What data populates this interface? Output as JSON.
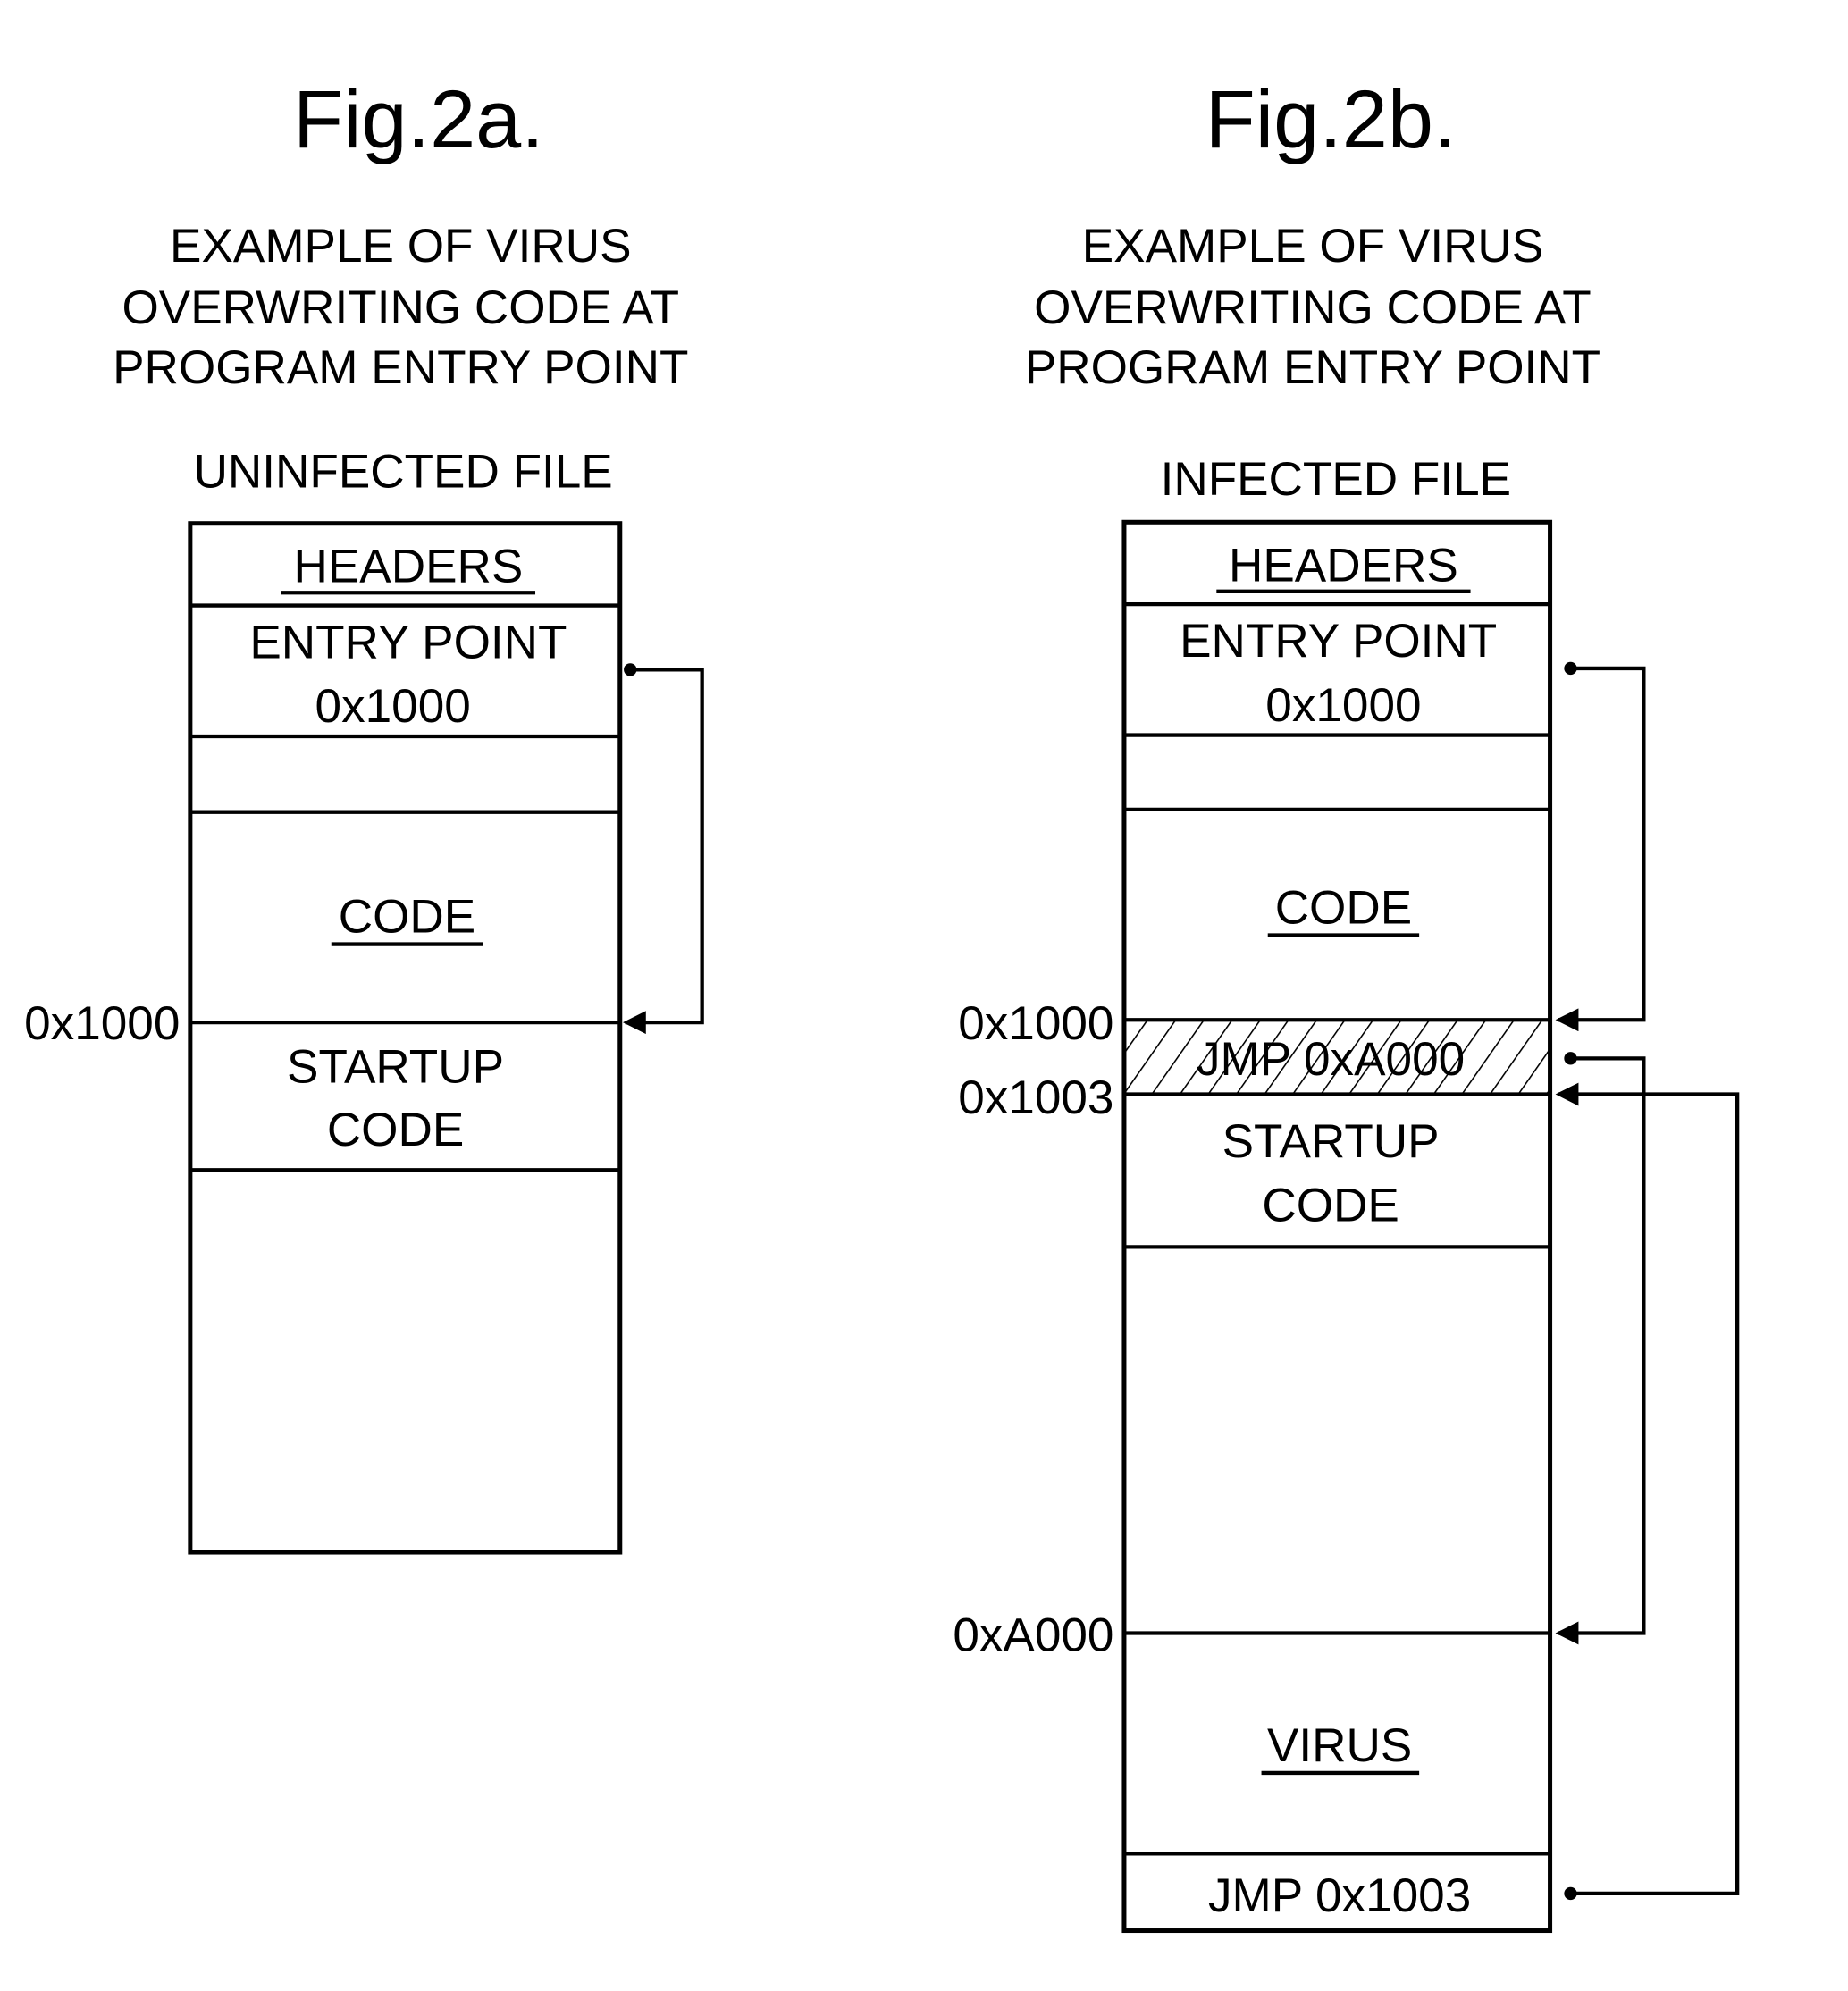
{
  "figures": [
    {
      "id": "fig2a",
      "title": "Fig.2a.",
      "caption": [
        "EXAMPLE OF VIRUS",
        "OVERWRITING CODE AT",
        "PROGRAM ENTRY POINT"
      ],
      "file_label": "UNINFECTED FILE",
      "sections": [
        {
          "lines": [
            "HEADERS"
          ],
          "underline": true
        },
        {
          "lines": [
            "ENTRY POINT",
            "0x1000"
          ],
          "underline": false
        },
        {
          "lines": [],
          "underline": false
        },
        {
          "lines": [
            "CODE"
          ],
          "underline": true
        },
        {
          "lines": [
            "STARTUP",
            "CODE"
          ],
          "underline": false
        },
        {
          "lines": [],
          "underline": false
        }
      ],
      "address_labels": [
        "0x1000"
      ],
      "arrows": [
        {
          "from": "ENTRY POINT 0x1000",
          "to": "0x1000 (STARTUP CODE)"
        }
      ]
    },
    {
      "id": "fig2b",
      "title": "Fig.2b.",
      "caption": [
        "EXAMPLE OF VIRUS",
        "OVERWRITING CODE AT",
        "PROGRAM ENTRY POINT"
      ],
      "file_label": "INFECTED FILE",
      "sections": [
        {
          "lines": [
            "HEADERS"
          ],
          "underline": true
        },
        {
          "lines": [
            "ENTRY POINT",
            "0x1000"
          ],
          "underline": false
        },
        {
          "lines": [],
          "underline": false
        },
        {
          "lines": [
            "CODE"
          ],
          "underline": true
        },
        {
          "lines": [
            "JMP 0xA000"
          ],
          "underline": false,
          "hatched": true
        },
        {
          "lines": [
            "STARTUP",
            "CODE"
          ],
          "underline": false
        },
        {
          "lines": [],
          "underline": false
        },
        {
          "lines": [
            "VIRUS"
          ],
          "underline": true
        },
        {
          "lines": [
            "JMP 0x1003"
          ],
          "underline": false
        }
      ],
      "address_labels": [
        "0x1000",
        "0x1003",
        "0xA000"
      ],
      "arrows": [
        {
          "from": "ENTRY POINT 0x1000",
          "to": "0x1000 (JMP 0xA000)"
        },
        {
          "from": "JMP 0xA000",
          "to": "0xA000 (VIRUS)"
        },
        {
          "from": "JMP 0x1003",
          "to": "0x1003 (STARTUP CODE)"
        }
      ]
    }
  ]
}
